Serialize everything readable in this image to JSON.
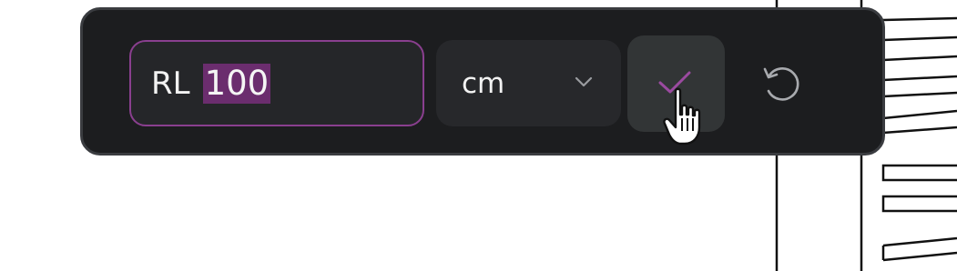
{
  "measurement_toolbar": {
    "value_field": {
      "prefix": "RL",
      "value": "100"
    },
    "unit_select": {
      "selected": "cm"
    },
    "confirm_button": {
      "icon": "checkmark-icon"
    },
    "reset_button": {
      "icon": "undo-icon"
    }
  },
  "colors": {
    "toolbar_background": "#1c1d1f",
    "accent": "#8a3f8f",
    "selection": "#6b2d6e"
  }
}
